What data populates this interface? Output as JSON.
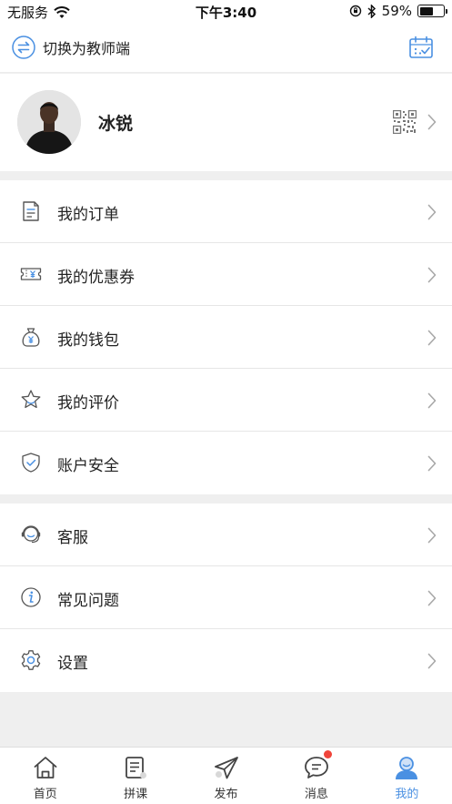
{
  "status_bar": {
    "carrier": "无服务",
    "time": "下午3:40",
    "battery": "59%",
    "battery_level": 0.59
  },
  "header": {
    "switch_label": "切换为教师端",
    "accent_color": "#4a90e2"
  },
  "profile": {
    "name": "冰锐"
  },
  "menu_groups": [
    {
      "items": [
        {
          "label": "我的订单",
          "icon": "order-icon"
        },
        {
          "label": "我的优惠券",
          "icon": "coupon-icon"
        },
        {
          "label": "我的钱包",
          "icon": "wallet-icon"
        },
        {
          "label": "我的评价",
          "icon": "star-icon"
        },
        {
          "label": "账户安全",
          "icon": "shield-icon"
        }
      ]
    },
    {
      "items": [
        {
          "label": "客服",
          "icon": "headset-icon"
        },
        {
          "label": "常见问题",
          "icon": "info-icon"
        },
        {
          "label": "设置",
          "icon": "gear-icon"
        }
      ]
    }
  ],
  "tabbar": {
    "tabs": [
      {
        "label": "首页",
        "icon": "home-icon",
        "active": false
      },
      {
        "label": "拼课",
        "icon": "notebook-icon",
        "active": false
      },
      {
        "label": "发布",
        "icon": "send-icon",
        "active": false
      },
      {
        "label": "消息",
        "icon": "chat-icon",
        "active": false,
        "badge": true
      },
      {
        "label": "我的",
        "icon": "profile-icon",
        "active": true
      }
    ]
  }
}
